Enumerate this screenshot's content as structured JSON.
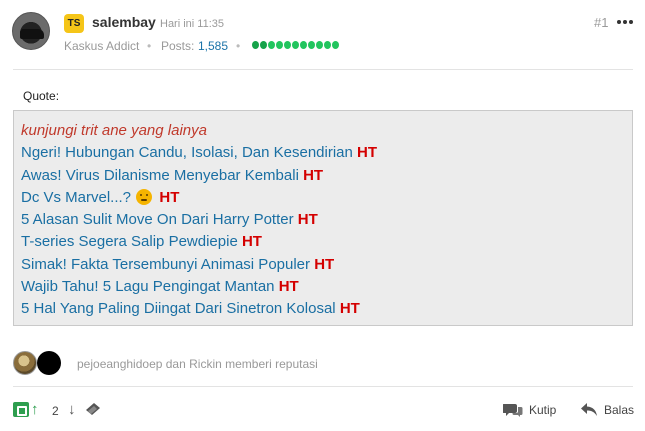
{
  "post": {
    "badge": "TS",
    "username": "salembay",
    "time": "Hari ini 11:35",
    "rank": "Kaskus Addict",
    "posts_label": "Posts:",
    "posts_count": "1,585",
    "post_number": "#1",
    "reputation_dots": 11
  },
  "quote": {
    "label": "Quote:",
    "intro": "kunjungi trit ane yang lainya",
    "ht_label": "HT",
    "links": [
      {
        "title": "Ngeri! Hubungan Candu, Isolasi, Dan Kesendirian",
        "emoji": false
      },
      {
        "title": "Awas! Virus Dilanisme Menyebar Kembali",
        "emoji": false
      },
      {
        "title": "Dc Vs Marvel...?",
        "emoji": true
      },
      {
        "title": "5 Alasan Sulit Move On Dari Harry Potter",
        "emoji": false
      },
      {
        "title": "T-series Segera Salip Pewdiepie",
        "emoji": false
      },
      {
        "title": "Simak! Fakta Tersembunyi Animasi Populer",
        "emoji": false
      },
      {
        "title": "Wajib Tahu! 5 Lagu Pengingat Mantan",
        "emoji": false
      },
      {
        "title": "5 Hal Yang Paling Diingat Dari Sinetron Kolosal",
        "emoji": false
      }
    ]
  },
  "reputation": {
    "text": "pejoeanghidoep dan Rickin memberi reputasi"
  },
  "footer": {
    "vote_count": "2",
    "quote_label": "Kutip",
    "reply_label": "Balas"
  },
  "colors": {
    "accent_link": "#1a6fa3",
    "ht": "#d40000",
    "intro": "#c0392b",
    "reputation_green": "#22c55e",
    "badge": "#f5c518"
  }
}
